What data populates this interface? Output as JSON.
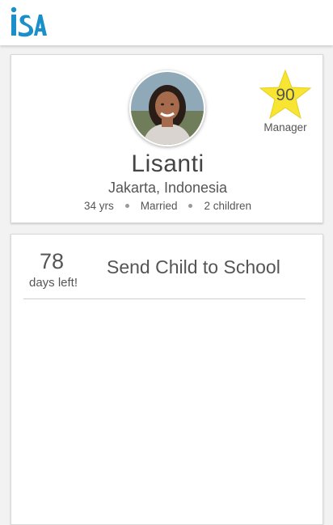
{
  "app": {
    "logo_text": "iSA",
    "brand_color": "#1a8fc9"
  },
  "profile": {
    "name": "Lisanti",
    "location": "Jakarta, Indonesia",
    "age": "34 yrs",
    "marital_status": "Married",
    "children": "2 children",
    "score": "90",
    "role": "Manager",
    "star_color": "#f7e531"
  },
  "goal": {
    "days": "78",
    "days_label": "days left!",
    "title": "Send Child to School"
  }
}
